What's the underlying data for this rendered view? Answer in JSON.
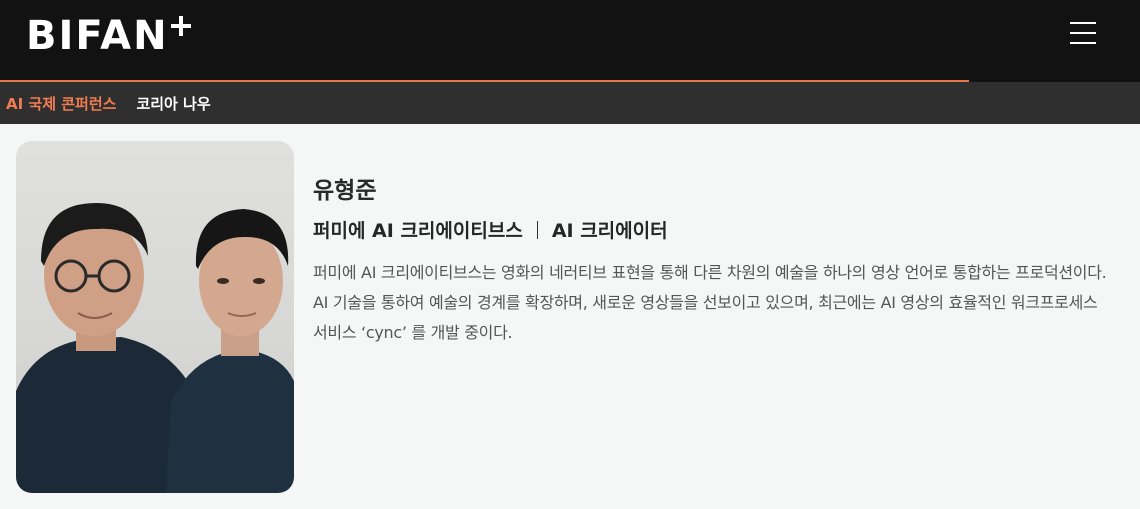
{
  "header": {
    "logo_text": "BIFAN"
  },
  "progress": {
    "value_percent": 85
  },
  "subnav": {
    "items": [
      {
        "label": "AI 국제 콘퍼런스",
        "active": true
      },
      {
        "label": "코리아 나우",
        "active": false
      }
    ]
  },
  "profile": {
    "name": "유형준",
    "company": "퍼미에 AI 크리에이티브스",
    "title": "AI 크리에이터",
    "bio": "퍼미에 AI 크리에이티브스는 영화의 네러티브 표현을 통해 다른 차원의 예술을 하나의 영상 언어로 통합하는 프로덕션이다. AI 기술을 통하여 예술의 경계를 확장하며, 새로운 영상들을 선보이고 있으며, 최근에는 AI 영상의 효율적인 워크프로세스 서비스 ‘cync’ 를 개발 중이다."
  },
  "colors": {
    "header_bg": "#121212",
    "subnav_bg": "#2f2f2f",
    "accent": "#f07d52",
    "page_bg": "#f5f7f6"
  },
  "icons": {
    "menu": "hamburger-icon",
    "logo_plus": "plus-icon"
  }
}
